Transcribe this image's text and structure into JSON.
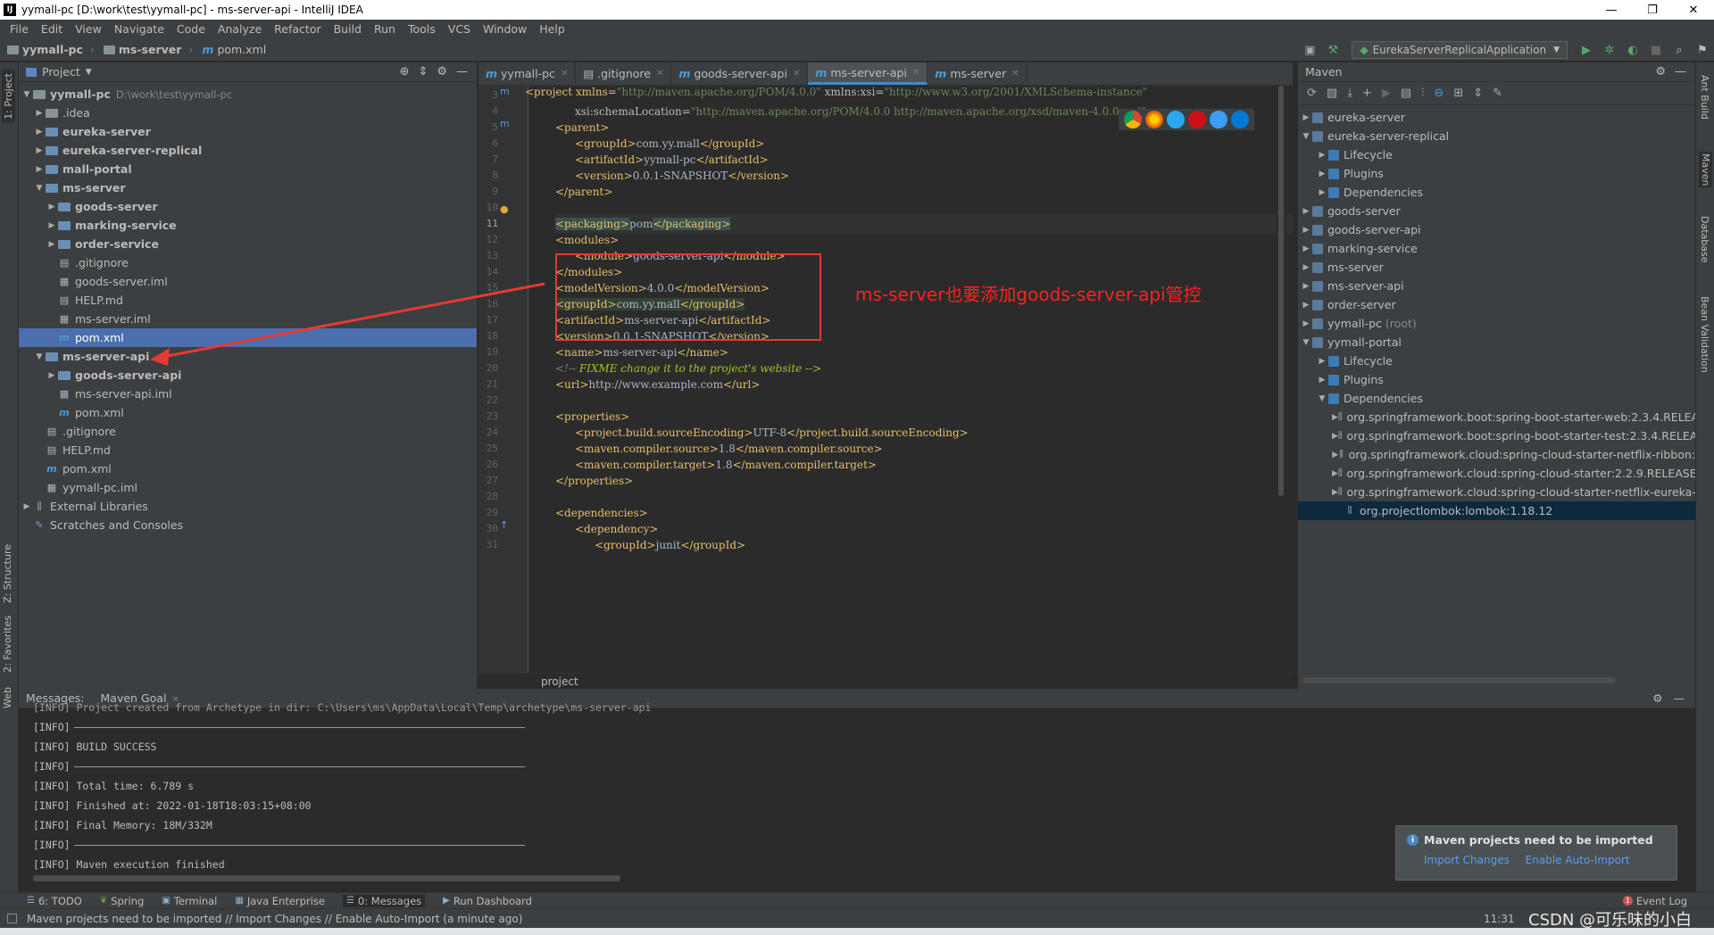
{
  "window": {
    "title": "yymall-pc [D:\\work\\test\\yymall-pc] - ms-server-api - IntelliJ IDEA",
    "app_icon": "IJ",
    "minimize": "—",
    "restore": "❐",
    "close": "✕"
  },
  "menu": [
    "File",
    "Edit",
    "View",
    "Navigate",
    "Code",
    "Analyze",
    "Refactor",
    "Build",
    "Run",
    "Tools",
    "VCS",
    "Window",
    "Help"
  ],
  "breadcrumb": [
    "yymall-pc",
    "ms-server",
    "pom.xml"
  ],
  "run_config": "EurekaServerReplicalApplication",
  "left_strip": {
    "project": "1: Project",
    "structure": "Z: Structure",
    "favorites": "2: Favorites",
    "web": "Web"
  },
  "right_strip": {
    "ant": "Ant Build",
    "maven": "Maven",
    "database": "Database",
    "bean": "Bean Validation"
  },
  "project_panel": {
    "title": "Project",
    "tree": [
      {
        "label": "yymall-pc",
        "extra": "D:\\work\\test\\yymall-pc"
      },
      {
        "label": ".idea"
      },
      {
        "label": "eureka-server"
      },
      {
        "label": "eureka-server-replical"
      },
      {
        "label": "mall-portal"
      },
      {
        "label": "ms-server"
      },
      {
        "label": "goods-server"
      },
      {
        "label": "marking-service"
      },
      {
        "label": "order-service"
      },
      {
        "label": ".gitignore"
      },
      {
        "label": "goods-server.iml"
      },
      {
        "label": "HELP.md"
      },
      {
        "label": "ms-server.iml"
      },
      {
        "label": "pom.xml"
      },
      {
        "label": "ms-server-api"
      },
      {
        "label": "goods-server-api"
      },
      {
        "label": "ms-server-api.iml"
      },
      {
        "label": "pom.xml"
      },
      {
        "label": ".gitignore"
      },
      {
        "label": "HELP.md"
      },
      {
        "label": "pom.xml"
      },
      {
        "label": "yymall-pc.iml"
      },
      {
        "label": "External Libraries"
      },
      {
        "label": "Scratches and Consoles"
      }
    ]
  },
  "editor_tabs": [
    {
      "label": "yymall-pc"
    },
    {
      "label": ".gitignore"
    },
    {
      "label": "goods-server-api"
    },
    {
      "label": "ms-server-api"
    },
    {
      "label": "ms-server"
    }
  ],
  "code": {
    "line_numbers": [
      "2",
      "3",
      "4",
      "5",
      "6",
      "7",
      "8",
      "9",
      "10",
      "11",
      "12",
      "13",
      "14",
      "15",
      "16",
      "17",
      "18",
      "19",
      "20",
      "21",
      "22",
      "23",
      "24",
      "25",
      "26",
      "27",
      "28",
      "29",
      "30",
      "31"
    ],
    "l3_open": "<project xmlns=",
    "l3_xmlns": "\"http://maven.apache.org/POM/4.0.0\"",
    "l3_xsi": " xmlns:xsi=",
    "l3_xsival": "\"http://www.w3.org/2001/XMLSchema-instance\"",
    "l4_schema": "xsi:schemaLocation=",
    "l4_val": "\"http://maven.apache.org/POM/4.0.0 http://maven.apache.org/xsd/maven-4.0.0.xsd\"",
    "l4_close": ">",
    "l5": "<parent>",
    "l6a": "<groupId>",
    "l6b": "com.yy.mall",
    "l6c": "</groupId>",
    "l7a": "<artifactId>",
    "l7b": "yymall-pc",
    "l7c": "</artifactId>",
    "l8a": "<version>",
    "l8b": "0.0.1-SNAPSHOT",
    "l8c": "</version>",
    "l9": "</parent>",
    "l11a": "<packaging>",
    "l11b": "pom",
    "l11c": "</packaging>",
    "l12": "<modules>",
    "l13a": "<module>",
    "l13b": "goods-server-api",
    "l13c": "</module>",
    "l14": "</modules>",
    "l15a": "<modelVersion>",
    "l15b": "4.0.0",
    "l15c": "</modelVersion>",
    "l16a": "<groupId>",
    "l16b": "com.yy.mall",
    "l16c": "</groupId>",
    "l17a": "<artifactId>",
    "l17b": "ms-server-api",
    "l17c": "</artifactId>",
    "l18a": "<version>",
    "l18b": "0.0.1-SNAPSHOT",
    "l18c": "</version>",
    "l19a": "<name>",
    "l19b": "ms-server-api",
    "l19c": "</name>",
    "l20a": "<!-- ",
    "l20b": "FIXME",
    "l20c": " change it to the project's website -->",
    "l21a": "<url>",
    "l21b": "http://www.example.com",
    "l21c": "</url>",
    "l23": "<properties>",
    "l24a": "<project.build.sourceEncoding>",
    "l24b": "UTF-8",
    "l24c": "</project.build.sourceEncoding>",
    "l25a": "<maven.compiler.source>",
    "l25b": "1.8",
    "l25c": "</maven.compiler.source>",
    "l26a": "<maven.compiler.target>",
    "l26b": "1.8",
    "l26c": "</maven.compiler.target>",
    "l27": "</properties>",
    "l29": "<dependencies>",
    "l30": "<dependency>",
    "l31a": "<groupId>",
    "l31b": "junit",
    "l31c": "</groupId>"
  },
  "editor_breadcrumb": "project",
  "annotation": "ms-server也要添加goods-server-api管控",
  "maven_panel": {
    "title": "Maven",
    "tree": [
      {
        "label": "eureka-server"
      },
      {
        "label": "eureka-server-replical"
      },
      {
        "label": "Lifecycle"
      },
      {
        "label": "Plugins"
      },
      {
        "label": "Dependencies"
      },
      {
        "label": "goods-server"
      },
      {
        "label": "goods-server-api"
      },
      {
        "label": "marking-service"
      },
      {
        "label": "ms-server"
      },
      {
        "label": "ms-server-api"
      },
      {
        "label": "order-server"
      },
      {
        "label": "yymall-pc",
        "extra": "(root)"
      },
      {
        "label": "yymall-portal"
      },
      {
        "label": "Lifecycle"
      },
      {
        "label": "Plugins"
      },
      {
        "label": "Dependencies"
      },
      {
        "label": "org.springframework.boot:spring-boot-starter-web:2.3.4.RELEA"
      },
      {
        "label": "org.springframework.boot:spring-boot-starter-test:2.3.4.RELEA"
      },
      {
        "label": "org.springframework.cloud:spring-cloud-starter-netflix-ribbon:"
      },
      {
        "label": "org.springframework.cloud:spring-cloud-starter:2.2.9.RELEASE"
      },
      {
        "label": "org.springframework.cloud:spring-cloud-starter-netflix-eureka-"
      },
      {
        "label": "org.projectlombok:lombok:1.18.12"
      }
    ]
  },
  "messages": {
    "tab1": "Messages:",
    "tab2": "Maven Goal",
    "lines": [
      "[INFO] Project created from Archetype in dir: C:\\Users\\ms\\AppData\\Local\\Temp\\archetype\\ms-server-api",
      "[INFO]",
      "[INFO] BUILD SUCCESS",
      "[INFO]",
      "[INFO] Total time: 6.789 s",
      "[INFO] Finished at: 2022-01-18T18:03:15+08:00",
      "[INFO] Final Memory: 18M/332M",
      "[INFO]",
      "[INFO] Maven execution finished"
    ]
  },
  "notification": {
    "title": "Maven projects need to be imported",
    "link1": "Import Changes",
    "link2": "Enable Auto-Import"
  },
  "tool_tabs": [
    "6: TODO",
    "Spring",
    "Terminal",
    "Java Enterprise",
    "0: Messages",
    "Run Dashboard"
  ],
  "event_log": "Event Log",
  "event_count": "1",
  "status": {
    "text": "Maven projects need to be imported // Import Changes // Enable Auto-Import (a minute ago)",
    "time": "11:31",
    "watermark": "CSDN @可乐味的小白"
  }
}
